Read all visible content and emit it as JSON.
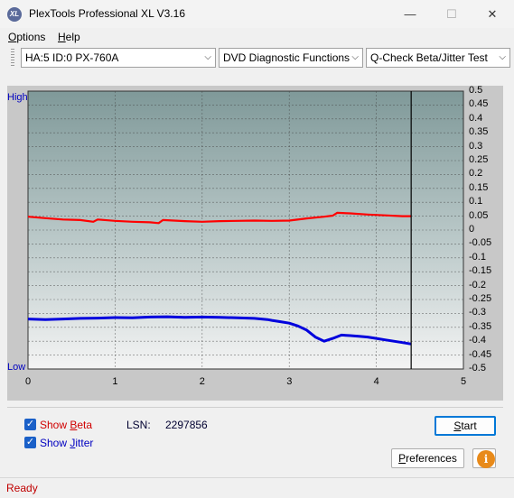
{
  "window": {
    "title": "PlexTools Professional XL V3.16",
    "icon_text": "XL",
    "controls": {
      "minimize": "—",
      "maximize": "☐",
      "close": "✕"
    }
  },
  "menu": {
    "items": [
      {
        "label_pre": "",
        "label_ul": "O",
        "label_post": "ptions"
      },
      {
        "label_pre": "",
        "label_ul": "H",
        "label_post": "elp"
      }
    ]
  },
  "toolbar": {
    "drive": "HA:5 ID:0  PX-760A",
    "function": "DVD Diagnostic Functions",
    "test": "Q-Check Beta/Jitter Test"
  },
  "chart_labels": {
    "high": "High",
    "low": "Low"
  },
  "chart_data": {
    "type": "line",
    "x_ticks": [
      "0",
      "1",
      "2",
      "3",
      "4",
      "5"
    ],
    "y_ticks": [
      "0.5",
      "0.45",
      "0.4",
      "0.35",
      "0.3",
      "0.25",
      "0.2",
      "0.15",
      "0.1",
      "0.05",
      "0",
      "-0.05",
      "-0.1",
      "-0.15",
      "-0.2",
      "-0.25",
      "-0.3",
      "-0.35",
      "-0.4",
      "-0.45",
      "-0.5"
    ],
    "xlim": [
      0,
      5
    ],
    "ylim": [
      -0.5,
      0.5
    ],
    "end_marker_x": 4.4,
    "grid": true,
    "background": "#7f9999",
    "series": [
      {
        "id": "beta",
        "color": "#ff0000",
        "x": [
          0,
          0.2,
          0.4,
          0.6,
          0.75,
          0.8,
          1.0,
          1.2,
          1.4,
          1.5,
          1.55,
          1.8,
          2.0,
          2.2,
          2.4,
          2.6,
          2.8,
          3.0,
          3.2,
          3.4,
          3.5,
          3.55,
          3.7,
          3.9,
          4.1,
          4.3,
          4.4
        ],
        "y": [
          0.048,
          0.043,
          0.038,
          0.036,
          0.03,
          0.038,
          0.033,
          0.03,
          0.028,
          0.025,
          0.036,
          0.032,
          0.03,
          0.032,
          0.033,
          0.034,
          0.033,
          0.034,
          0.042,
          0.048,
          0.052,
          0.062,
          0.06,
          0.056,
          0.053,
          0.05,
          0.05
        ]
      },
      {
        "id": "jitter",
        "color": "#0000dd",
        "x": [
          0,
          0.2,
          0.4,
          0.6,
          0.8,
          1.0,
          1.2,
          1.4,
          1.6,
          1.8,
          2.0,
          2.2,
          2.4,
          2.6,
          2.75,
          2.8,
          2.9,
          3.0,
          3.1,
          3.2,
          3.3,
          3.4,
          3.5,
          3.6,
          3.7,
          3.8,
          3.9,
          4.0,
          4.1,
          4.2,
          4.3,
          4.4
        ],
        "y": [
          -0.32,
          -0.322,
          -0.32,
          -0.318,
          -0.317,
          -0.315,
          -0.316,
          -0.313,
          -0.312,
          -0.314,
          -0.313,
          -0.314,
          -0.316,
          -0.318,
          -0.322,
          -0.325,
          -0.33,
          -0.335,
          -0.345,
          -0.36,
          -0.385,
          -0.4,
          -0.39,
          -0.378,
          -0.38,
          -0.382,
          -0.385,
          -0.39,
          -0.395,
          -0.4,
          -0.405,
          -0.41
        ]
      }
    ]
  },
  "options": {
    "show_beta_pre": "Show ",
    "show_beta_ul": "B",
    "show_beta_post": "eta",
    "show_jitter_pre": "Show ",
    "show_jitter_ul": "J",
    "show_jitter_post": "itter",
    "beta_color": "#d00000",
    "jitter_color": "#0000c0",
    "check_mark": "✓"
  },
  "lsn": {
    "label": "LSN:",
    "value": "2297856"
  },
  "buttons": {
    "start_ul": "S",
    "start_post": "tart",
    "preferences_pre": "",
    "preferences_ul": "P",
    "preferences_post": "references",
    "info": "i"
  },
  "status": {
    "text": "Ready"
  }
}
